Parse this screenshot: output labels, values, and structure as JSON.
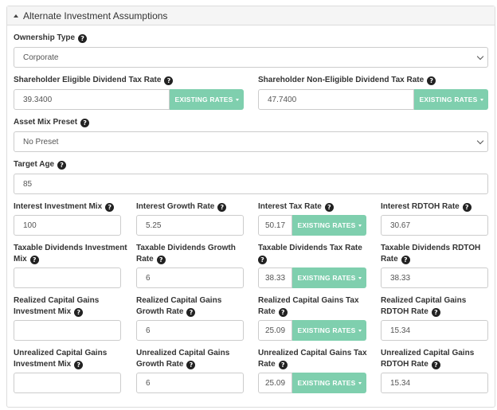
{
  "panel": {
    "title": "Alternate Investment Assumptions"
  },
  "ownership": {
    "label": "Ownership Type",
    "value": "Corporate"
  },
  "eligible": {
    "label": "Shareholder Eligible Dividend Tax Rate",
    "value": "39.3400",
    "button": "EXISTING RATES"
  },
  "non_eligible": {
    "label": "Shareholder Non-Eligible Dividend Tax Rate",
    "value": "47.7400",
    "button": "EXISTING RATES"
  },
  "asset_mix": {
    "label": "Asset Mix Preset",
    "value": "No Preset"
  },
  "target_age": {
    "label": "Target Age",
    "value": "85"
  },
  "interest": {
    "mix_label": "Interest Investment Mix",
    "mix_value": "100",
    "growth_label": "Interest Growth Rate",
    "growth_value": "5.25",
    "tax_label": "Interest Tax Rate",
    "tax_value": "50.17",
    "rdtoh_label": "Interest RDTOH Rate",
    "rdtoh_value": "30.67",
    "button": "EXISTING RATES"
  },
  "tax_div": {
    "mix_label_1": "Taxable Dividends Investment",
    "mix_label_2": "Mix",
    "mix_value": "",
    "growth_label_1": "Taxable Dividends Growth",
    "growth_label_2": "Rate",
    "growth_value": "6",
    "tax_label": "Taxable Dividends Tax Rate",
    "tax_value": "38.33",
    "rdtoh_label_1": "Taxable Dividends RDTOH",
    "rdtoh_label_2": "Rate",
    "rdtoh_value": "38.33",
    "button": "EXISTING RATES"
  },
  "realized": {
    "mix_label_1": "Realized Capital Gains",
    "mix_label_2": "Investment Mix",
    "mix_value": "",
    "growth_label_1": "Realized Capital Gains",
    "growth_label_2": "Growth Rate",
    "growth_value": "6",
    "tax_label_1": "Realized Capital Gains Tax",
    "tax_label_2": "Rate",
    "tax_value": "25.09",
    "rdtoh_label_1": "Realized Capital Gains",
    "rdtoh_label_2": "RDTOH Rate",
    "rdtoh_value": "15.34",
    "button": "EXISTING RATES"
  },
  "unrealized": {
    "mix_label_1": "Unrealized Capital Gains",
    "mix_label_2": "Investment Mix",
    "mix_value": "",
    "growth_label_1": "Unrealized Capital Gains",
    "growth_label_2": "Growth Rate",
    "growth_value": "6",
    "tax_label_1": "Unrealized Capital Gains Tax",
    "tax_label_2": "Rate",
    "tax_value": "25.09",
    "rdtoh_label_1": "Unrealized Capital Gains",
    "rdtoh_label_2": "RDTOH Rate",
    "rdtoh_value": "15.34",
    "button": "EXISTING RATES"
  },
  "icons": {
    "help": "question-circle-icon",
    "dropdown": "chevron-down-icon",
    "collapse": "caret-up-icon"
  },
  "colors": {
    "button": "#7fcfae",
    "header_bg": "#f5f5f5",
    "border": "#cccccc"
  }
}
